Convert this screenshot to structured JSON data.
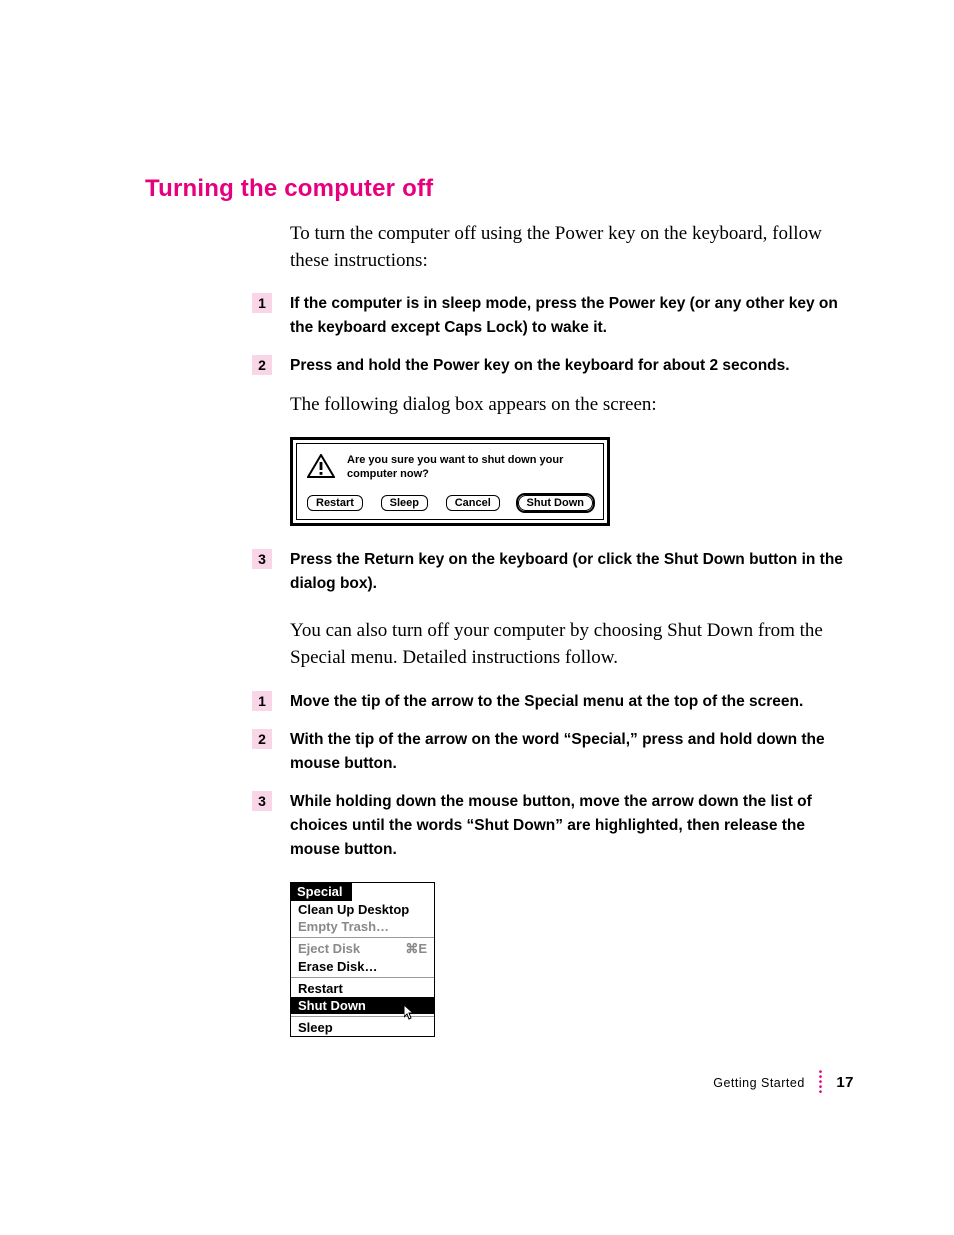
{
  "section_title": "Turning the computer off",
  "intro": "To turn the computer off using the Power key on the keyboard, follow these instructions:",
  "steps_a": [
    {
      "n": "1",
      "text": "If the computer is in sleep mode, press the Power key (or any other key on the keyboard except Caps Lock) to wake it."
    },
    {
      "n": "2",
      "text": "Press and hold the Power key on the keyboard for about 2 seconds."
    }
  ],
  "dialog_lead": "The following dialog box appears on the screen:",
  "dialog": {
    "message": "Are you sure you want to shut down your computer now?",
    "buttons": {
      "restart": "Restart",
      "sleep": "Sleep",
      "cancel": "Cancel",
      "shutdown": "Shut Down"
    }
  },
  "step_a3": {
    "n": "3",
    "text": "Press the Return key on the keyboard (or click the Shut Down button in the dialog box)."
  },
  "alt_text": "You can also turn off your computer by choosing Shut Down from the Special menu. Detailed instructions follow.",
  "steps_b": [
    {
      "n": "1",
      "text": "Move the tip of the arrow to the Special menu at the top of the screen."
    },
    {
      "n": "2",
      "text": "With the tip of the arrow on the word “Special,” press and hold down the mouse button."
    },
    {
      "n": "3",
      "text": "While holding down the mouse button, move the arrow down the list of choices until the words “Shut Down” are highlighted, then release the mouse button."
    }
  ],
  "menu": {
    "title": "Special",
    "items": {
      "cleanup": "Clean Up Desktop",
      "empty": "Empty Trash…",
      "eject": "Eject Disk",
      "eject_key": "⌘E",
      "erase": "Erase Disk…",
      "restart": "Restart",
      "shutdown": "Shut Down",
      "sleep": "Sleep"
    }
  },
  "footer": {
    "section": "Getting Started",
    "page": "17"
  }
}
